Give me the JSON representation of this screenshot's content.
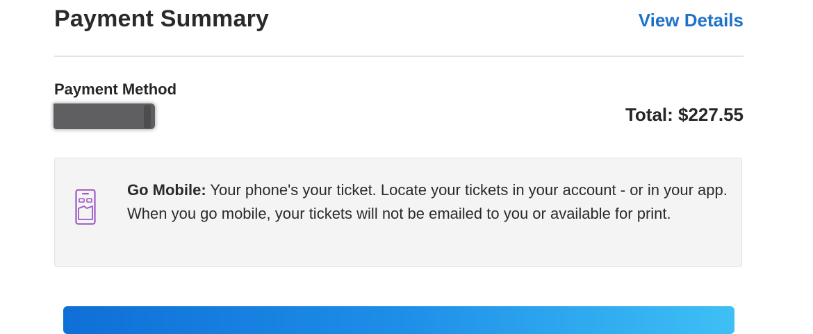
{
  "header": {
    "title": "Payment Summary",
    "view_details_label": "View Details"
  },
  "payment": {
    "method_label": "Payment Method",
    "total_text": "Total: $227.55"
  },
  "mobile_notice": {
    "heading": "Go Mobile:",
    "body": " Your phone's your ticket. Locate your tickets in your account - or in your app. When you go mobile, your tickets will not be emailed to you or available for print."
  },
  "colors": {
    "link": "#1f72c9",
    "icon_purple": "#9b59c4",
    "button_gradient_start": "#0f6fd6",
    "button_gradient_end": "#3ec0f5"
  },
  "icons": {
    "mobile_notice_icon": "mobile-phone-icon"
  }
}
